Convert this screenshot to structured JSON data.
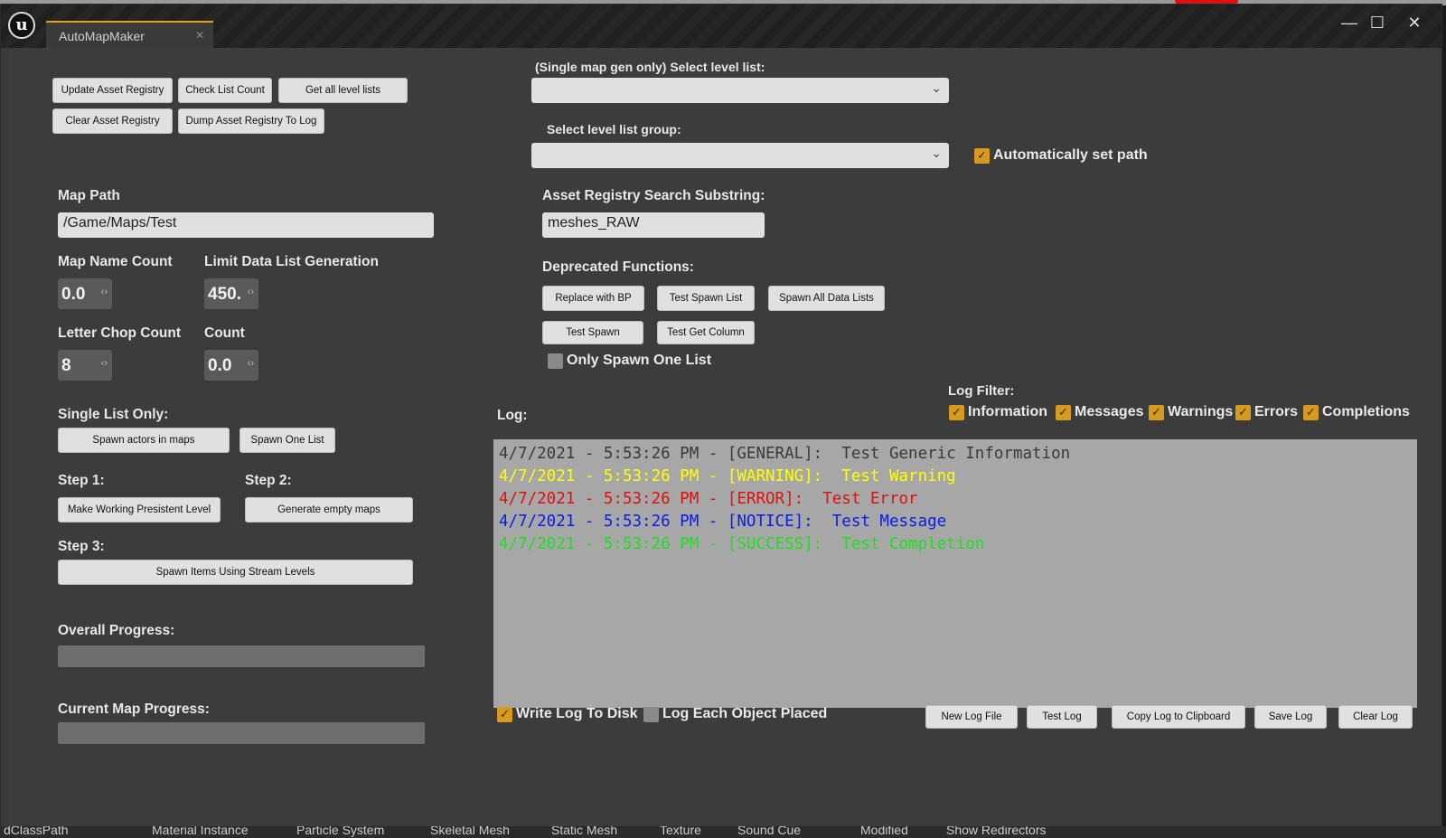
{
  "app": {
    "tab_title": "AutoMapMaker",
    "tab_close": "✕"
  },
  "window_controls": {
    "minimize": "—",
    "maximize": "☐",
    "close": "✕"
  },
  "top_buttons": {
    "update_asset_registry": "Update Asset Registry",
    "check_list_count": "Check List Count",
    "get_all_level_lists": "Get all level lists",
    "clear_asset_registry": "Clear Asset Registry",
    "dump_asset_registry": "Dump Asset Registry To Log"
  },
  "level_list": {
    "label": "(Single map gen only) Select level list:",
    "value": ""
  },
  "level_list_group": {
    "label": "Select level list group:",
    "value": ""
  },
  "auto_set_path": {
    "label": "Automatically set path",
    "checked": true
  },
  "map_path": {
    "label": "Map Path",
    "value": "/Game/Maps/Test"
  },
  "asset_search": {
    "label": "Asset Registry Search Substring:",
    "value": "meshes_RAW"
  },
  "map_name_count": {
    "label": "Map Name Count",
    "value": "0.0"
  },
  "limit_data": {
    "label": "Limit Data List Generation",
    "value": "450."
  },
  "letter_chop": {
    "label": "Letter Chop Count",
    "value": "8"
  },
  "count": {
    "label": "Count",
    "value": "0.0"
  },
  "deprecated": {
    "label": "Deprecated Functions:",
    "replace_bp": "Replace with BP",
    "test_spawn_list": "Test Spawn List",
    "spawn_all_data": "Spawn All Data Lists",
    "test_spawn": "Test Spawn",
    "test_get_column": "Test Get Column",
    "only_spawn_one": "Only Spawn One List"
  },
  "single_list": {
    "label": "Single List Only:",
    "spawn_actors": "Spawn actors in maps",
    "spawn_one": "Spawn One List"
  },
  "steps": {
    "step1": "Step 1:",
    "step1_btn": "Make Working Presistent Level",
    "step2": "Step 2:",
    "step2_btn": "Generate empty maps",
    "step3": "Step 3:",
    "step3_btn": "Spawn Items Using Stream Levels"
  },
  "progress": {
    "overall_label": "Overall Progress:",
    "overall_value": 0,
    "current_label": "Current Map Progress:",
    "current_value": 0
  },
  "log_filter": {
    "label": "Log Filter:",
    "information": "Information",
    "messages": "Messages",
    "warnings": "Warnings",
    "errors": "Errors",
    "completions": "Completions"
  },
  "log": {
    "label": "Log:",
    "lines": [
      {
        "text": "4/7/2021 - 5:53:26 PM - [GENERAL]:  Test Generic Information",
        "color": "#3a3a3a"
      },
      {
        "text": "4/7/2021 - 5:53:26 PM - [WARNING]:  Test Warning",
        "color": "#ffff00"
      },
      {
        "text": "4/7/2021 - 5:53:26 PM - [ERROR]:  Test Error",
        "color": "#e01010"
      },
      {
        "text": "4/7/2021 - 5:53:26 PM - [NOTICE]:  Test Message",
        "color": "#0a1ee0"
      },
      {
        "text": "4/7/2021 - 5:53:26 PM - [SUCCESS]:  Test Completion",
        "color": "#20e020"
      }
    ]
  },
  "log_options": {
    "write_to_disk": "Write Log To Disk",
    "log_each_object": "Log Each Object Placed"
  },
  "log_buttons": {
    "new_log_file": "New Log File",
    "test_log": "Test Log",
    "copy_log": "Copy Log to Clipboard",
    "save_log": "Save Log",
    "clear_log": "Clear Log"
  },
  "bottom_bar": [
    "dClassPath",
    "Material Instance",
    "Particle System",
    "Skeletal Mesh",
    "Static Mesh",
    "Texture",
    "Sound Cue",
    "Modified",
    "Show Redirectors"
  ],
  "colors": {
    "accent": "#d69a1c",
    "background": "#3c3c3c",
    "log_bg": "#a7a7a7"
  }
}
